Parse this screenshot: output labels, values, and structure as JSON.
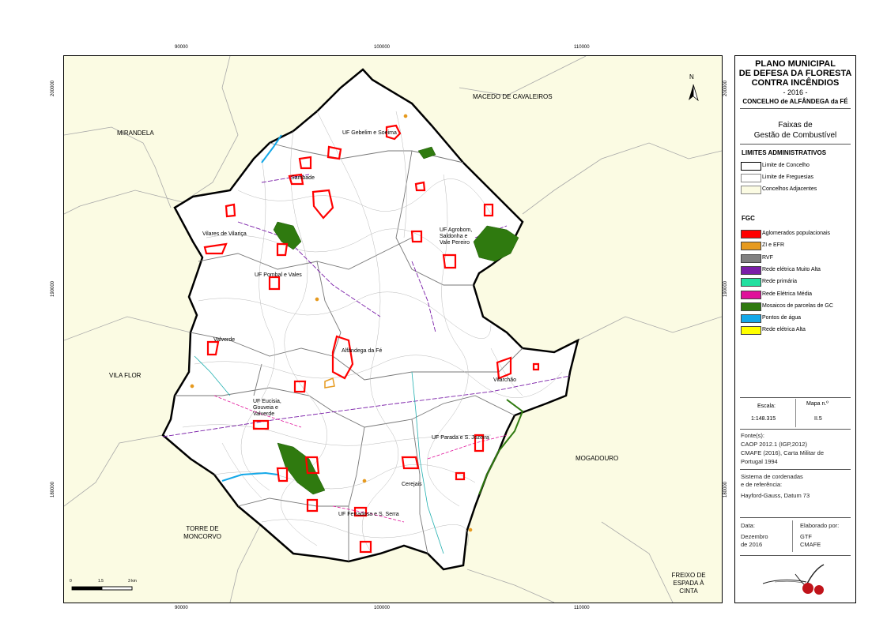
{
  "map": {
    "top_ticks": [
      "90000",
      "100000",
      "110000"
    ],
    "bottom_ticks": [
      "90000",
      "100000",
      "110000"
    ],
    "left_ticks": [
      "200000",
      "190000",
      "180000"
    ],
    "right_ticks": [
      "200000",
      "190000",
      "180000"
    ],
    "north_label": "N",
    "neighbors": {
      "macedo": "MACEDO DE CAVALEIROS",
      "mirandela": "MIRANDELA",
      "vila_flor": "VILA FLOR",
      "mogadouro": "MOGADOURO",
      "torre": "TORRE DE MONCORVO",
      "freixo": "FREIXO DE ESPADA À CINTA"
    },
    "parishes": {
      "gebelim": "UF Gebelim e Soeima",
      "sambade": "Sambade",
      "vilares": "Vilares de Vilariça",
      "agrobom": "UF Agrobom, Saldonha e Vale Pereiro",
      "pombal": "UF Pombal e Vales",
      "valverde": "Valverde",
      "alfandega": "Alfândega da Fé",
      "vilarchao": "Vilarchão",
      "eucisia": "UF Eucisia, Gouveia e Valverde",
      "parada": "UF Parada e S. Jozeira",
      "cerejais": "Cerejais",
      "ferradosa": "UF Ferradosa e S. Serra"
    },
    "scale_bar": [
      "0",
      "1.5",
      "3 km"
    ]
  },
  "legend": {
    "title_lines": [
      "PLANO MUNICIPAL",
      "DE DEFESA DA FLORESTA",
      "CONTRA INCÊNDIOS"
    ],
    "year": "- 2016 -",
    "concelho": "CONCELHO de ALFÂNDEGA da FÉ",
    "subtitle_lines": [
      "Faixas de",
      "Gestão de Combustível"
    ],
    "admin_title": "LIMITES ADMINISTRATIVOS",
    "admin_items": [
      {
        "label": "Limite de Concelho",
        "fill": "#ffffff",
        "border": "#000000"
      },
      {
        "label": "Limite de Freguesias",
        "fill": "#ffffff",
        "border": "#888888"
      },
      {
        "label": "Concelhos Adjacentes",
        "fill": "#fbfbe3",
        "border": "#888888"
      }
    ],
    "fgc_title": "FGC",
    "fgc_items": [
      {
        "label": "Aglomerados populacionais",
        "color": "#ff0000"
      },
      {
        "label": "ZI e EFR",
        "color": "#e69a1f"
      },
      {
        "label": "RVF",
        "color": "#808080"
      },
      {
        "label": "Rede elétrica Muito Alta",
        "color": "#7a1ea8"
      },
      {
        "label": "Rede primária",
        "color": "#22e0a0"
      },
      {
        "label": "Rede Elétrica Média",
        "color": "#e0109a"
      },
      {
        "label": "Mosaicos de parcelas de GC",
        "color": "#2f7a0f"
      },
      {
        "label": "Pontos de água",
        "color": "#14a8e8"
      },
      {
        "label": "Rede elétrica Alta",
        "color": "#ffff00"
      }
    ],
    "escala_label": "Escala:",
    "escala_value": "1:148.315",
    "mapa_label": "Mapa n.º",
    "mapa_value": "II.5",
    "fonte_label": "Fonte(s):",
    "fonte_lines": [
      "CAOP 2012.1 (IGP,2012)",
      "CMAFE (2016), Carta Militar de",
      "Portugal 1994"
    ],
    "sistema_lines": [
      "Sistema de cordenadas",
      "e de referência:"
    ],
    "sistema_value": "Hayford-Gauss, Datum 73",
    "data_label": "Data:",
    "data_lines": [
      "Dezembro",
      "de 2016"
    ],
    "elaborado_label": "Elaborado por:",
    "elaborado_lines": [
      "GTF",
      "CMAFE"
    ]
  }
}
